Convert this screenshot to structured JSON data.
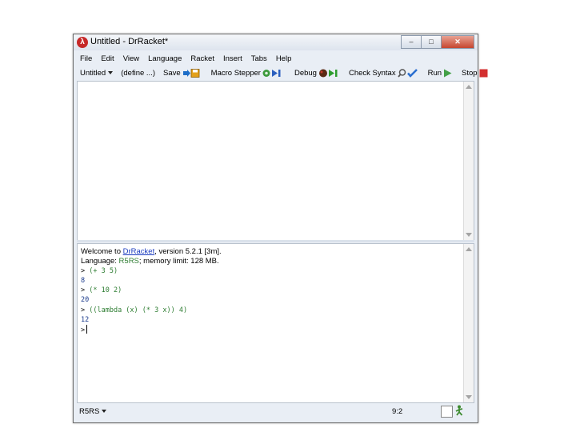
{
  "window": {
    "title": "Untitled - DrRacket*",
    "controls": {
      "minimize": "‒",
      "maximize": "□",
      "close": "✕"
    }
  },
  "menu": [
    "File",
    "Edit",
    "View",
    "Language",
    "Racket",
    "Insert",
    "Tabs",
    "Help"
  ],
  "toolbar": {
    "untitled": "Untitled",
    "define": "(define ...)",
    "save": "Save",
    "macro_stepper": "Macro Stepper",
    "debug": "Debug",
    "check_syntax": "Check Syntax",
    "run": "Run",
    "stop": "Stop"
  },
  "repl": {
    "welcome_prefix": "Welcome to ",
    "welcome_link": "DrRacket",
    "welcome_suffix": ", version 5.2.1 [3m].",
    "language_prefix": "Language: ",
    "language_name": "R5RS",
    "language_suffix": "; memory limit: 128 MB.",
    "prompt": ">",
    "entries": [
      {
        "input": "(+ 3 5)",
        "output": "8"
      },
      {
        "input": "(* 10 2)",
        "output": "20"
      },
      {
        "input": "((lambda (x) (* 3 x)) 4)",
        "output": "12"
      }
    ]
  },
  "status": {
    "language": "R5RS",
    "position": "9:2"
  },
  "colors": {
    "input": "#2e7d32",
    "output": "#1b3a8c",
    "link": "#1a3bbf",
    "stop": "#d32f2f",
    "run": "#43a047"
  }
}
